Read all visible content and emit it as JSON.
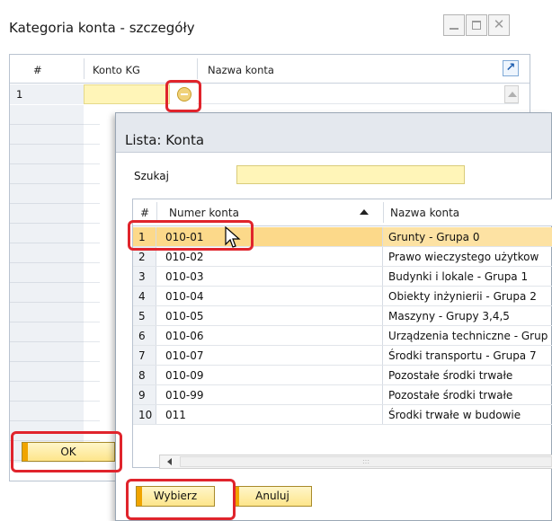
{
  "back_window": {
    "title": "Kategoria konta - szczegóły",
    "columns": {
      "num": "#",
      "konto": "Konto KG",
      "nazwa": "Nazwa konta"
    },
    "row1_num": "1",
    "ok_label": "OK",
    "dashes": "--"
  },
  "front_window": {
    "title": "Lista: Konta",
    "search_label": "Szukaj",
    "search_value": "",
    "columns": {
      "num": "#",
      "numer": "Numer konta",
      "nazwa": "Nazwa konta"
    },
    "rows": [
      {
        "num": "1",
        "numer": "010-01",
        "nazwa": "Grunty - Grupa 0"
      },
      {
        "num": "2",
        "numer": "010-02",
        "nazwa": "Prawo wieczystego użytkow"
      },
      {
        "num": "3",
        "numer": "010-03",
        "nazwa": "Budynki  i lokale - Grupa 1"
      },
      {
        "num": "4",
        "numer": "010-04",
        "nazwa": "Obiekty inżynierii - Grupa 2"
      },
      {
        "num": "5",
        "numer": "010-05",
        "nazwa": "Maszyny - Grupy 3,4,5"
      },
      {
        "num": "6",
        "numer": "010-06",
        "nazwa": "Urządzenia techniczne - Grup"
      },
      {
        "num": "7",
        "numer": "010-07",
        "nazwa": "Środki transportu - Grupa 7"
      },
      {
        "num": "8",
        "numer": "010-09",
        "nazwa": "Pozostałe środki trwałe"
      },
      {
        "num": "9",
        "numer": "010-99",
        "nazwa": "Pozostałe środki trwałe"
      },
      {
        "num": "10",
        "numer": "011",
        "nazwa": "Środki trwałe w budowie"
      }
    ],
    "scroll_grip": ":::",
    "select_label": "Wybierz",
    "cancel_label": "Anuluj"
  }
}
